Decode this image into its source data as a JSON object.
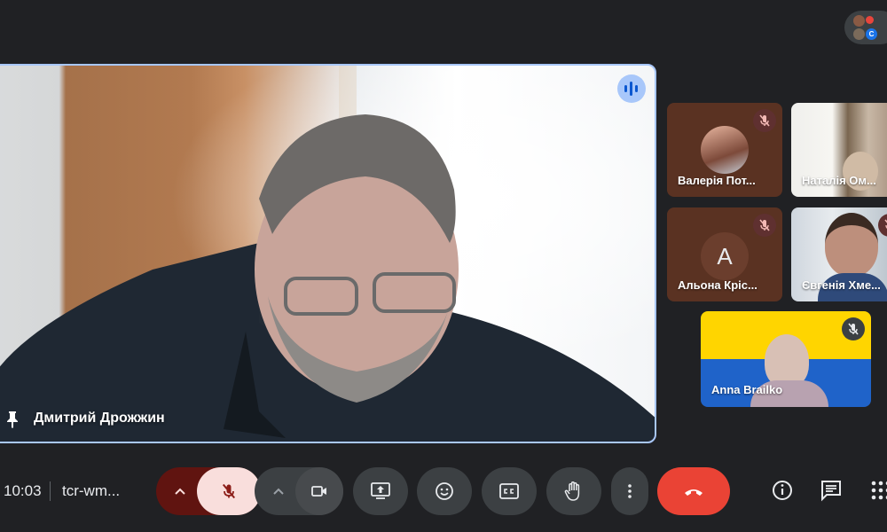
{
  "top_bar": {
    "people_chip": {
      "avatar_1_color": "#8a5a44",
      "avatar_2_letter": "",
      "avatar_2_color": "#e8453c",
      "avatar_3_color": "#7a6a5a",
      "avatar_4_letter": "С",
      "avatar_4_color": "#1a73e8"
    }
  },
  "main_tile": {
    "participant_name": "Дмитрий Дрожжин",
    "pin_icon": "pin-icon",
    "speaking_indicator": "speaking-icon"
  },
  "side_tiles": [
    {
      "name": "Валерія Пот...",
      "muted": true
    },
    {
      "name": "Наталія Ом...",
      "muted": false
    },
    {
      "name": "Альона Кріс...",
      "muted": true,
      "avatar_letter": "А"
    },
    {
      "name": "Євгенія Хме...",
      "muted": true
    },
    {
      "name": "Anna Brailko",
      "muted": true
    }
  ],
  "bottom_bar": {
    "time": "10:03",
    "meeting_code": "tcr-wm...",
    "controls": {
      "mic_options": "chevron-up-icon",
      "mic": "mic-off-icon",
      "camera_options": "chevron-up-icon",
      "camera": "videocam-icon",
      "present": "present-screen-icon",
      "emoji": "emoji-icon",
      "captions": "captions-icon",
      "raise_hand": "hand-icon",
      "more": "more-vert-icon",
      "leave": "call-end-icon"
    },
    "right": {
      "info": "info-icon",
      "chat": "chat-icon",
      "activities": "apps-icon"
    }
  },
  "colors": {
    "background": "#202124",
    "speaking_border": "#a8c7fa",
    "leave_red": "#ea4335",
    "mic_muted_bg": "#f9dedc",
    "mic_muted_dark": "#8c1d18"
  }
}
